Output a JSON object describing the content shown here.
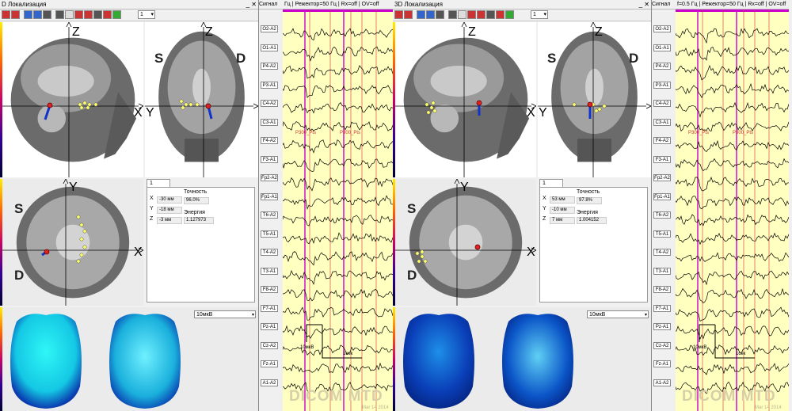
{
  "screens": [
    {
      "id": "left",
      "title": "D Локализация",
      "signal_title": "Сигнал",
      "signal_header": "Гц | Режектор=50 Гц | Rx=off | OV=off",
      "toolbar_select": "1",
      "axes": {
        "sagittal": {
          "v": "Z",
          "h": "X"
        },
        "coronal": {
          "v": "Z",
          "h": "Y"
        },
        "axial": {
          "v": "Y",
          "h": "X"
        }
      },
      "orientation": {
        "coronal_left": "S",
        "coronal_right": "D",
        "axial_top": "S",
        "axial_bottom": "D"
      },
      "info": {
        "tab": "1",
        "x_label": "X",
        "x_value": "-30 мм",
        "y_label": "Y",
        "y_value": "-18 мм",
        "z_label": "Z",
        "z_value": "-3 мм",
        "accuracy_label": "Точность",
        "accuracy_value": "96.0%",
        "energy_label": "Энергия",
        "energy_value": "1.127973"
      },
      "amplitude_select": "10мкВ",
      "scale_amp": "10мкВ",
      "scale_time": "1сек",
      "marker_a": "P300_Pts",
      "marker_b": "P300_Pts",
      "watermark": "DICOM MTD",
      "watermark_date": "Mar 14 2014"
    },
    {
      "id": "right",
      "title": "3D Локализация",
      "signal_title": "Сигнал",
      "signal_header": "f=0.5 Гц | Режектор=50 Гц | Rx=off | OV=off",
      "toolbar_select": "1",
      "axes": {
        "sagittal": {
          "v": "Z",
          "h": "X"
        },
        "coronal": {
          "v": "Z",
          "h": "Y"
        },
        "axial": {
          "v": "Y",
          "h": "X"
        }
      },
      "orientation": {
        "coronal_left": "S",
        "coronal_right": "D",
        "axial_top": "S",
        "axial_bottom": "D"
      },
      "info": {
        "tab": "1",
        "x_label": "X",
        "x_value": "53 мм",
        "y_label": "Y",
        "y_value": "-10 мм",
        "z_label": "Z",
        "z_value": "7 мм",
        "accuracy_label": "Точность",
        "accuracy_value": "97.8%",
        "energy_label": "Энергия",
        "energy_value": "1.004152"
      },
      "amplitude_select": "10мкВ",
      "scale_amp": "10мкВ",
      "scale_time": "1сек",
      "marker_a": "P300_Pts",
      "marker_b": "P300_Pts",
      "watermark": "DICOM MTD",
      "watermark_date": "Mar 14 2014"
    }
  ],
  "channels": [
    "O2-A2",
    "O1-A1",
    "P4-A2",
    "P3-A1",
    "C4-A2",
    "C3-A1",
    "F4-A2",
    "F3-A1",
    "Fp2-A2",
    "Fp1-A1",
    "T6-A2",
    "T5-A1",
    "T4-A2",
    "T3-A1",
    "F8-A2",
    "F7-A1",
    "Pz-A1",
    "Cz-A2",
    "Fz-A1",
    "A1-A2"
  ],
  "colors": {
    "plot_bg": "#ffffc0",
    "marker_purple": "#cc00cc",
    "marker_red": "#cc3333",
    "dipole_red": "#dd2222",
    "dipole_blue": "#1133cc",
    "dots": "#ffff66",
    "map_left": "#22e0f0",
    "map_right": "#1a5fd6"
  }
}
